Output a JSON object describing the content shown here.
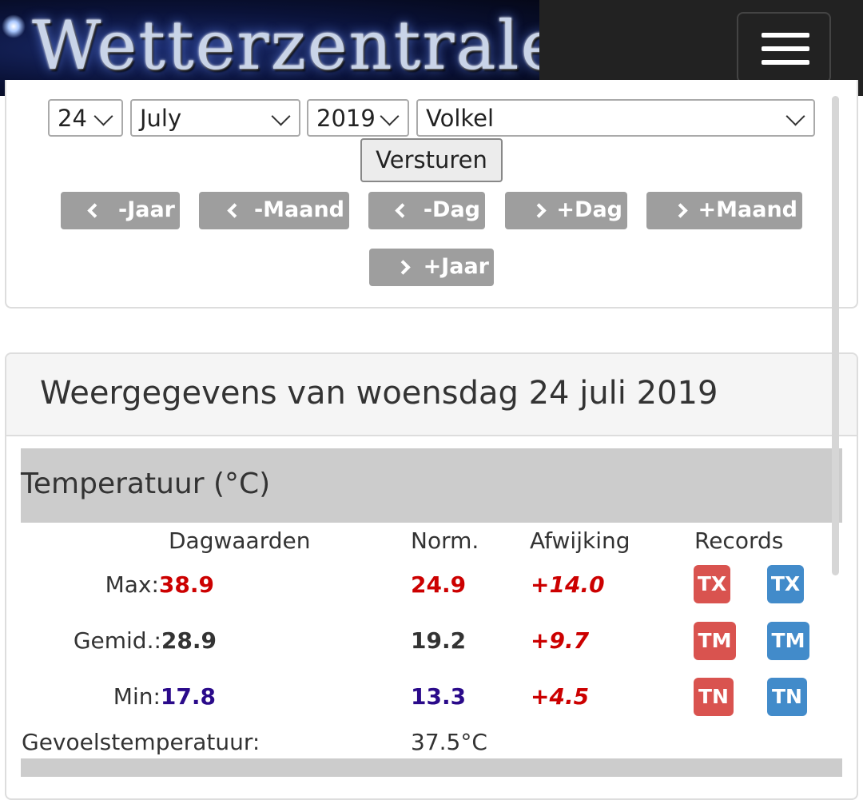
{
  "header": {
    "logo_text": "Wetterzentrale",
    "menu_icon": "hamburger-icon"
  },
  "form": {
    "day": "24",
    "month": "July",
    "year": "2019",
    "station": "Volkel",
    "submit_label": "Versturen",
    "nav_buttons": [
      "-Jaar",
      "-Maand",
      "-Dag",
      "+Dag",
      "+Maand",
      "+Jaar"
    ]
  },
  "weather": {
    "title": "Weergegevens van woensdag 24 juli 2019",
    "section_title": "Temperatuur (°C)",
    "columns": [
      "Dagwaarden",
      "Norm.",
      "Afwijking",
      "Records"
    ],
    "rows": [
      {
        "label": "Max:",
        "value": "38.9",
        "norm": "24.9",
        "deviation": "+14.0",
        "records": [
          "TX",
          "TX"
        ]
      },
      {
        "label": "Gemid.:",
        "value": "28.9",
        "norm": "19.2",
        "deviation": "+9.7",
        "records": [
          "TM",
          "TM"
        ]
      },
      {
        "label": "Min:",
        "value": "17.8",
        "norm": "13.3",
        "deviation": "+4.5",
        "records": [
          "TN",
          "TN"
        ]
      }
    ],
    "feels_like_label": "Gevoelstemperatuur:",
    "feels_like_value": "37.5°C"
  },
  "colors": {
    "max": "#cc0000",
    "mean": "#333333",
    "min": "#2a0a8a",
    "record_red": "#d9534f",
    "record_blue": "#428bca",
    "nav_button": "#9e9e9e"
  }
}
